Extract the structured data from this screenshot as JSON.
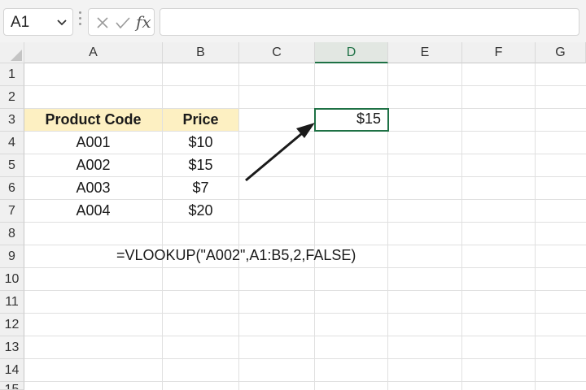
{
  "name_box": {
    "value": "A1"
  },
  "formula_bar": {
    "fx_label": "fx",
    "value": ""
  },
  "columns": [
    "A",
    "B",
    "C",
    "D",
    "E",
    "F",
    "G"
  ],
  "rows": [
    "1",
    "2",
    "3",
    "4",
    "5",
    "6",
    "7",
    "8",
    "9",
    "10",
    "11",
    "12",
    "13",
    "14",
    "15"
  ],
  "table": {
    "headers": [
      "Product Code",
      "Price"
    ],
    "rows": [
      [
        "A001",
        "$10"
      ],
      [
        "A002",
        "$15"
      ],
      [
        "A003",
        "$7"
      ],
      [
        "A004",
        "$20"
      ]
    ]
  },
  "result_cell": {
    "value": "$15"
  },
  "formula_note": "=VLOOKUP(\"A002\",A1:B5,2,FALSE)",
  "colors": {
    "header_fill": "#fdf0c2",
    "selection": "#1e7145"
  }
}
